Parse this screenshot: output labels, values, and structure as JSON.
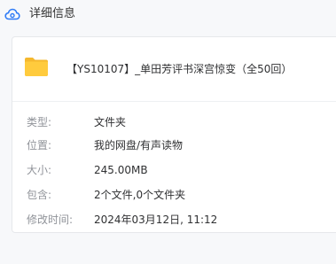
{
  "header": {
    "title": "详细信息"
  },
  "file": {
    "name": "【YS10107】_单田芳评书深宫惊变（全50回）",
    "icon": "folder-icon",
    "icon_color": "#ffcb3d"
  },
  "details": [
    {
      "label": "类型:",
      "value": "文件夹"
    },
    {
      "label": "位置:",
      "value": "我的网盘/有声读物"
    },
    {
      "label": "大小:",
      "value": "245.00MB"
    },
    {
      "label": "包含:",
      "value": "2个文件,0个文件夹"
    },
    {
      "label": "修改时间:",
      "value": "2024年03月12日, 11:12"
    }
  ],
  "colors": {
    "brand_cloud": "#2f7bf6",
    "label_gray": "#909399",
    "text_dark": "#303133"
  }
}
